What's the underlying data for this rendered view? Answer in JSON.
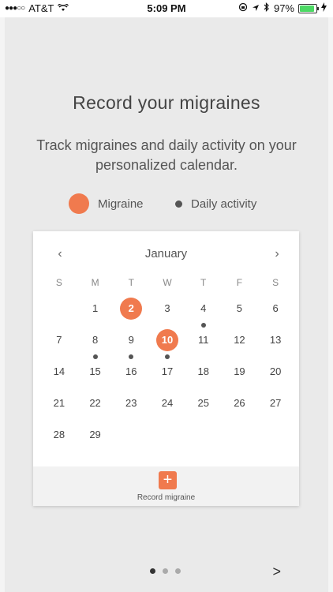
{
  "status_bar": {
    "carrier": "AT&T",
    "time": "5:09 PM",
    "battery": "97%",
    "icons": [
      "signal-dots-icon",
      "wifi-icon",
      "lock-rotation-icon",
      "location-arrow-icon",
      "bluetooth-icon",
      "battery-icon"
    ]
  },
  "onboarding": {
    "title": "Record your migraines",
    "subtitle": "Track migraines and daily activity on your personalized calendar."
  },
  "legend": {
    "migraine_label": "Migraine",
    "activity_label": "Daily activity"
  },
  "calendar": {
    "month": "January",
    "prev": "‹",
    "next": "›",
    "weekdays": [
      "S",
      "M",
      "T",
      "W",
      "T",
      "F",
      "S"
    ],
    "leading_blanks": 1,
    "days_in_month": 29,
    "migraine_days": [
      2,
      10
    ],
    "activity_days": [
      4,
      8,
      9,
      10
    ]
  },
  "record": {
    "icon": "+",
    "label": "Record migraine"
  },
  "pager": {
    "count": 3,
    "active_index": 0,
    "next_arrow": ">"
  },
  "colors": {
    "accent": "#f07a4e",
    "activity_dot": "#555555",
    "background": "#eaeaea"
  }
}
